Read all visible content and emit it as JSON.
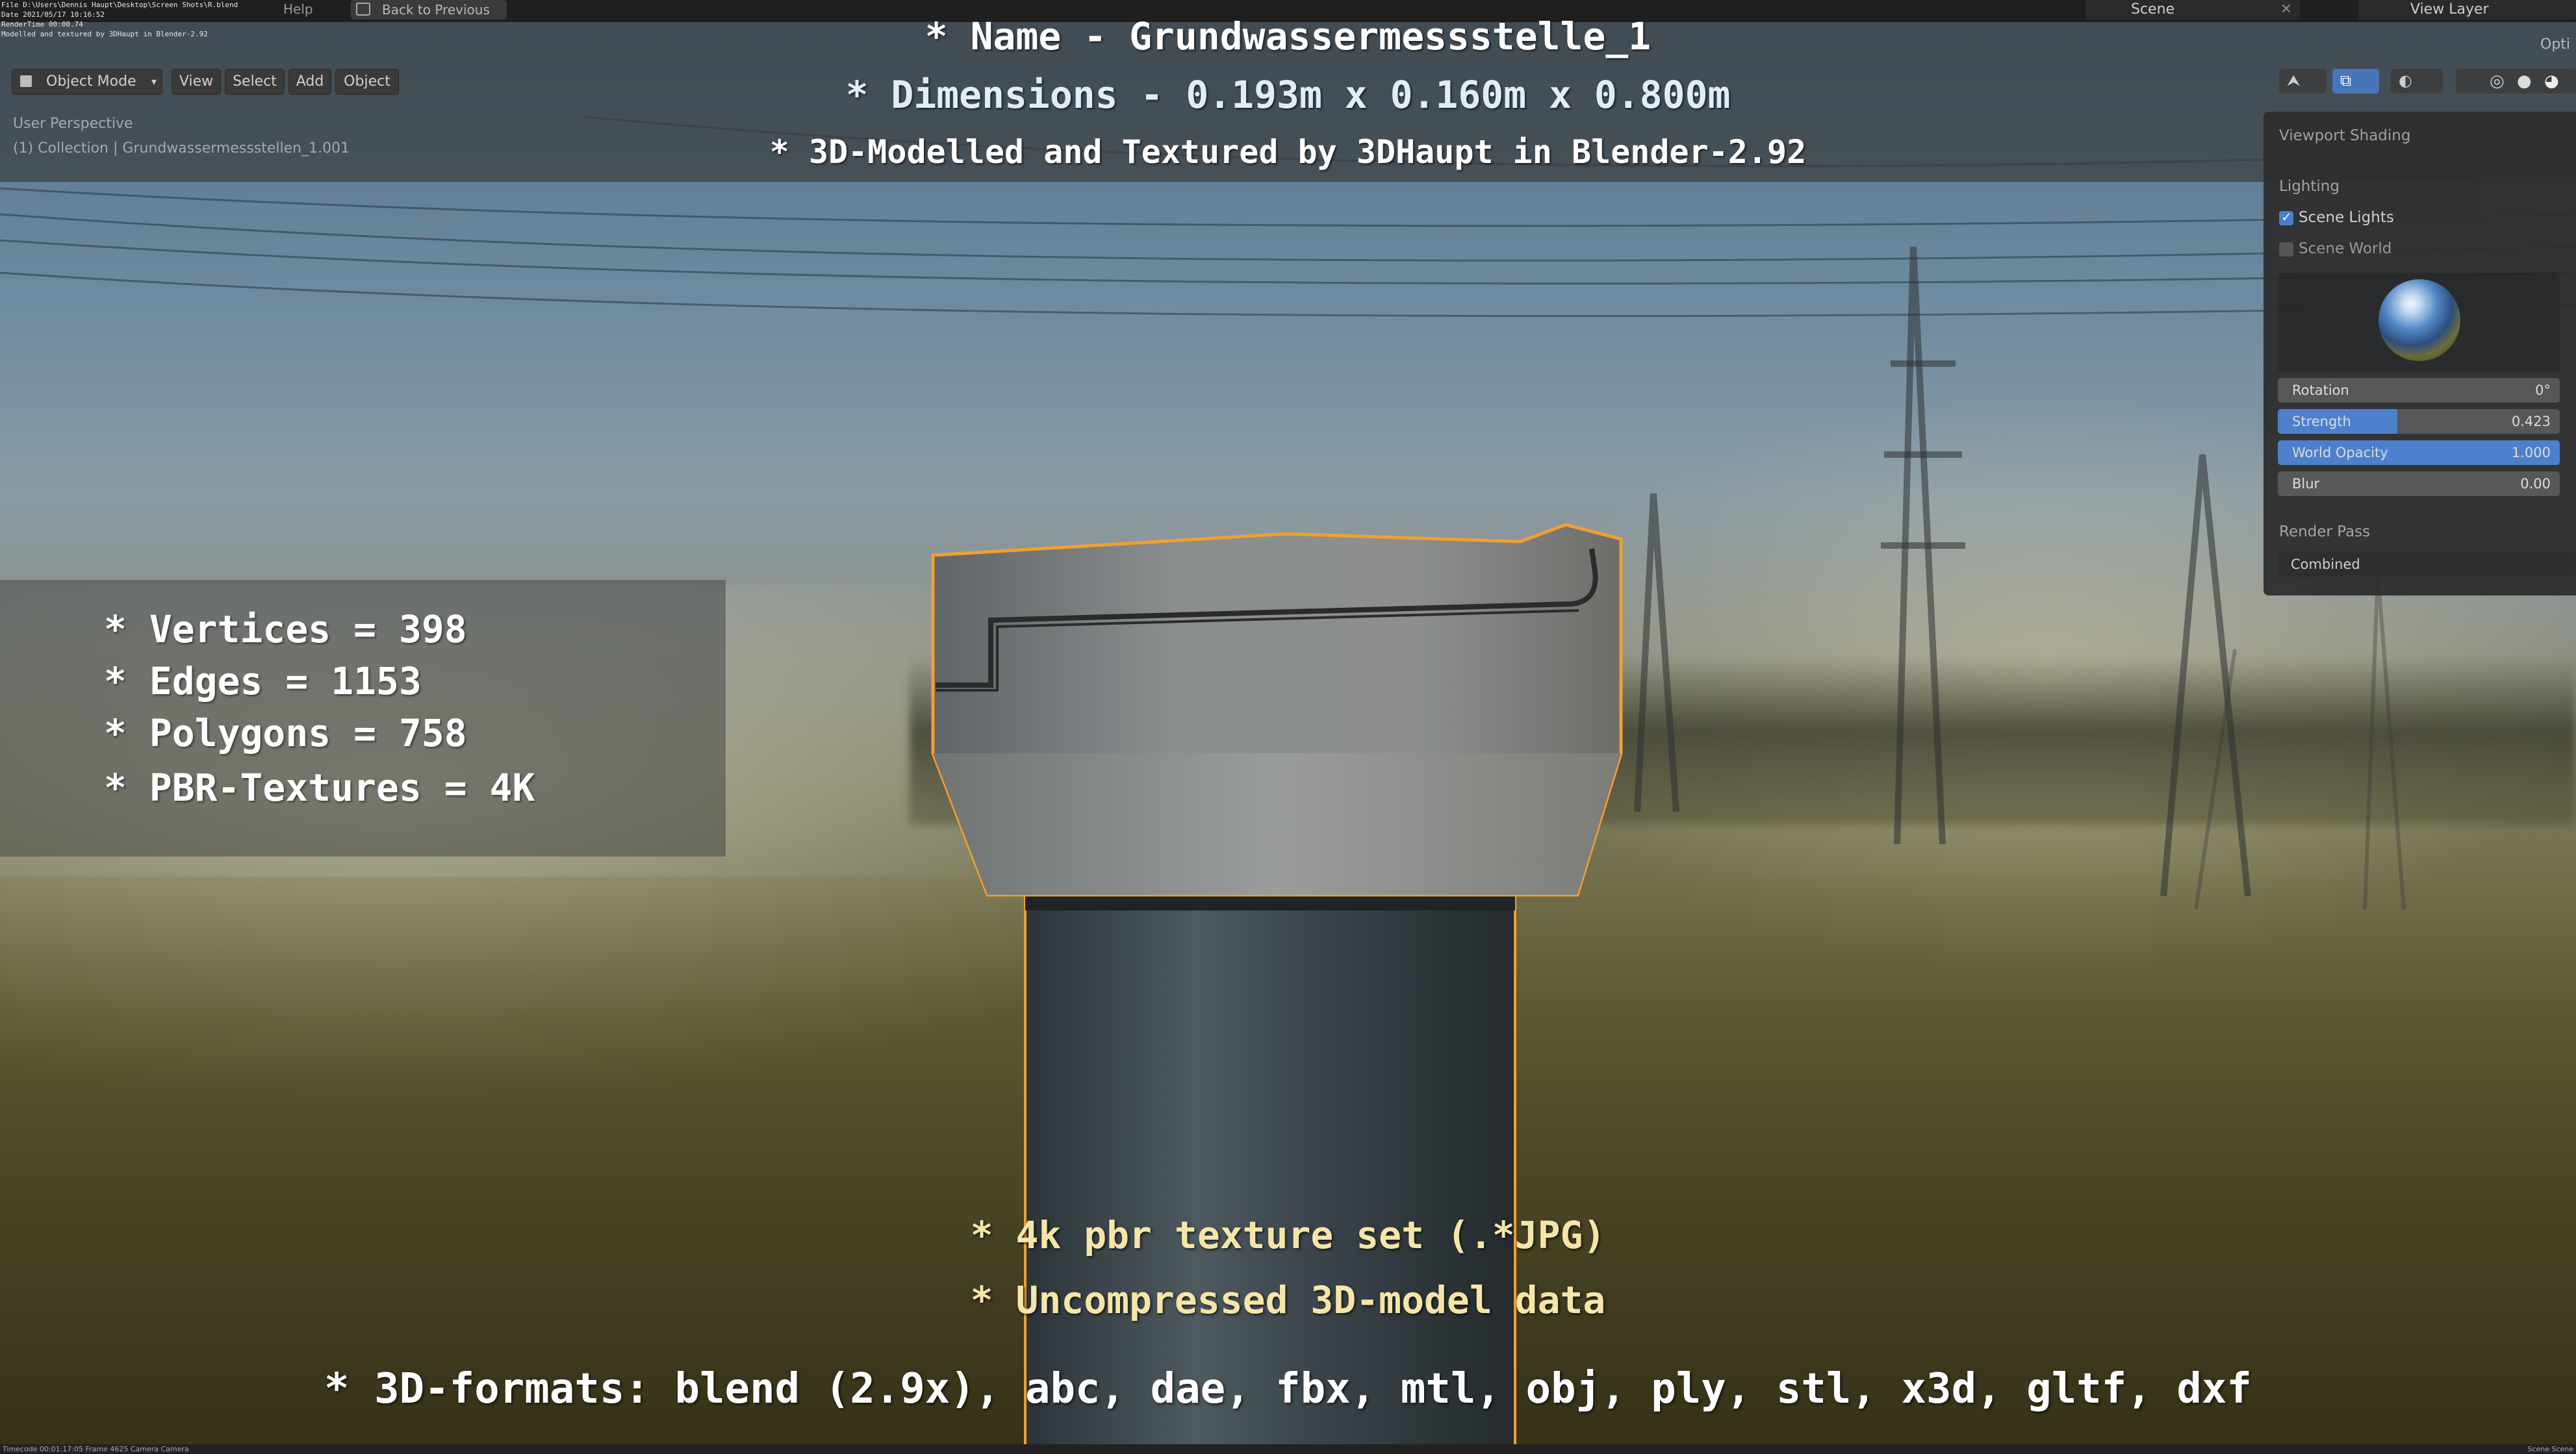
{
  "menubar": {
    "help": "Help",
    "back": "Back to Previous",
    "scene": "Scene",
    "view_layer": "View Layer",
    "opt": "Opti"
  },
  "stamp": {
    "line1": "File D:\\Users\\Dennis Haupt\\Desktop\\Screen Shots\\R.blend",
    "line2": "Date 2021/05/17 10:16:52",
    "line3": "RenderTime 00:00.74",
    "line4": "Modelled and textured by 3DHaupt in Blender-2.92"
  },
  "header": {
    "mode": "Object Mode",
    "view": "View",
    "select": "Select",
    "add": "Add",
    "object": "Object"
  },
  "viewport": {
    "perspective": "User Perspective",
    "collection": "(1) Collection | Grundwassermessstellen_1.001"
  },
  "title": {
    "name": "* Name - Grundwassermessstelle_1",
    "dimensions": "* Dimensions -  0.193m x 0.160m x 0.800m",
    "credit": "* 3D-Modelled and Textured by 3DHaupt in Blender-2.92"
  },
  "stats": [
    "* Vertices = 398",
    "* Edges = 1153",
    "* Polygons = 758",
    "* PBR-Textures = 4K"
  ],
  "bottom": {
    "textures": "* 4k pbr texture set (.*JPG)",
    "uncompressed": "* Uncompressed 3D-model data",
    "formats": "* 3D-formats: blend (2.9x), abc, dae, fbx, mtl, obj, ply, stl, x3d, gltf, dxf"
  },
  "shading": {
    "title": "Viewport Shading",
    "lighting": "Lighting",
    "scene_lights": "Scene Lights",
    "scene_lights_checked": true,
    "scene_world": "Scene World",
    "scene_world_checked": false,
    "rotation_label": "Rotation",
    "rotation_value": "0°",
    "strength_label": "Strength",
    "strength_value": "0.423",
    "opacity_label": "World Opacity",
    "opacity_value": "1.000",
    "blur_label": "Blur",
    "blur_value": "0.00",
    "render_pass": "Render Pass",
    "render_pass_value": "Combined"
  },
  "statusbar": {
    "left": "Timecode 00:01:17:05    Frame 4625    Camera Camera",
    "right": "Scene Scene"
  },
  "colors": {
    "accent_blue": "#4a7fcf",
    "selection_outline": "#f0a030",
    "yellow_text": "#f5e6a8"
  }
}
